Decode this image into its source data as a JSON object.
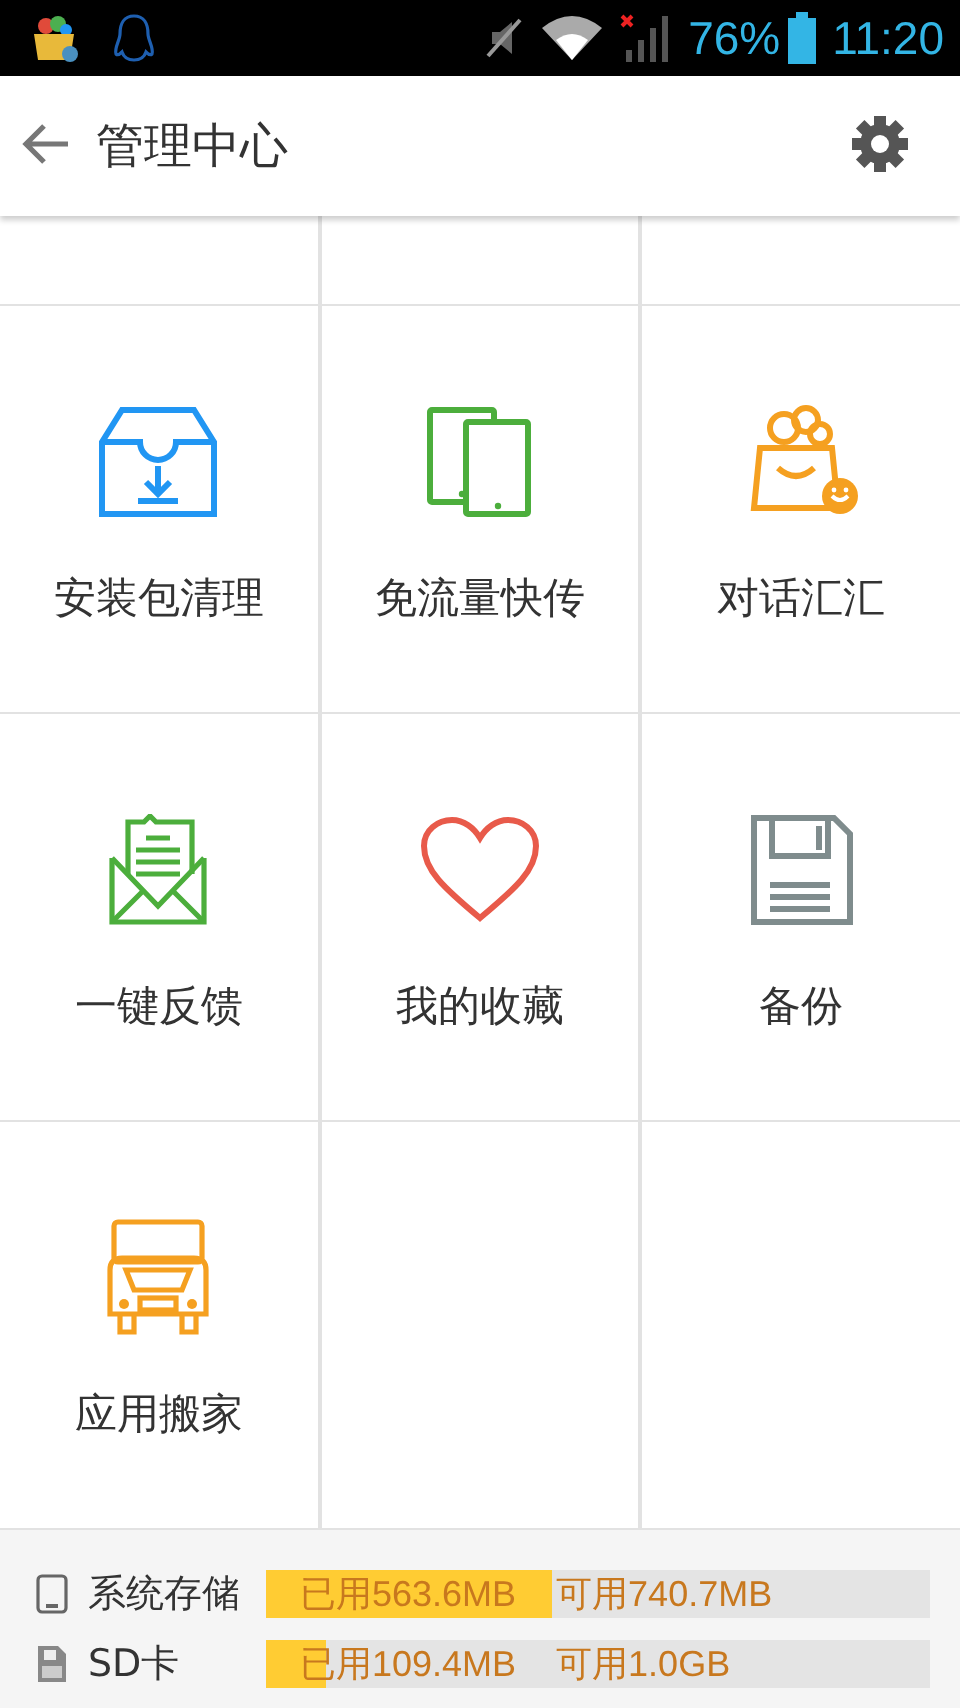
{
  "status_bar": {
    "battery": "76%",
    "time": "11:20"
  },
  "toolbar": {
    "title": "管理中心"
  },
  "grid": {
    "items": [
      {
        "label": "安装包清理"
      },
      {
        "label": "免流量快传"
      },
      {
        "label": "对话汇汇"
      },
      {
        "label": "一键反馈"
      },
      {
        "label": "我的收藏"
      },
      {
        "label": "备份"
      },
      {
        "label": "应用搬家"
      }
    ]
  },
  "storage": [
    {
      "kind": "system",
      "name": "系统存储",
      "used": "已用563.6MB",
      "free": "可用740.7MB",
      "level": 0.43
    },
    {
      "kind": "sd",
      "name": "SD卡",
      "used": "已用109.4MB",
      "free": "可用1.0GB",
      "level": 0.09
    }
  ]
}
